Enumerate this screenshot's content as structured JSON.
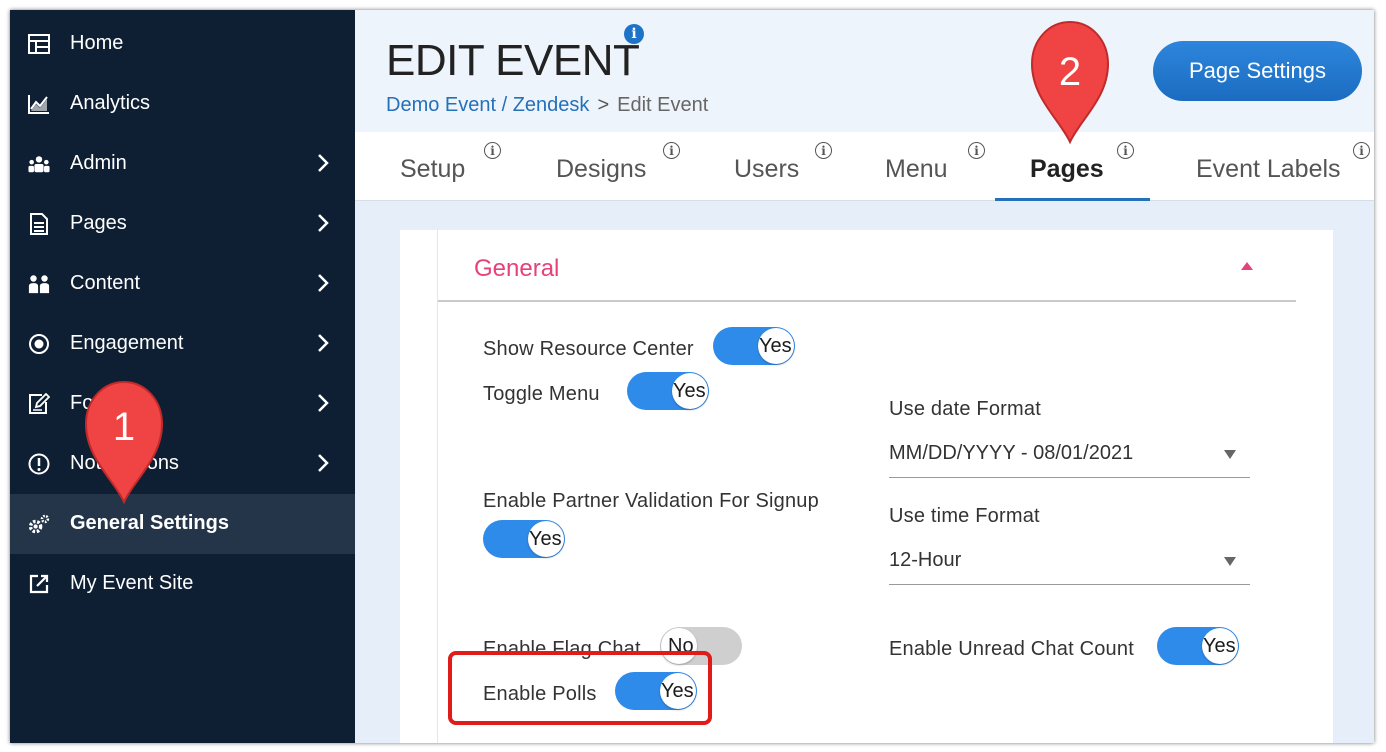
{
  "sidebar": {
    "items": [
      {
        "label": "Home",
        "icon": "home-grid-icon",
        "chevron": false
      },
      {
        "label": "Analytics",
        "icon": "analytics-chart-icon",
        "chevron": false
      },
      {
        "label": "Admin",
        "icon": "admin-users-icon",
        "chevron": true
      },
      {
        "label": "Pages",
        "icon": "document-icon",
        "chevron": true
      },
      {
        "label": "Content",
        "icon": "content-people-icon",
        "chevron": true
      },
      {
        "label": "Engagement",
        "icon": "target-icon",
        "chevron": true
      },
      {
        "label": "Forms",
        "icon": "edit-form-icon",
        "chevron": true
      },
      {
        "label": "Notifications",
        "icon": "alert-circle-icon",
        "chevron": true
      },
      {
        "label": "General Settings",
        "icon": "gears-icon",
        "chevron": false,
        "active": true
      },
      {
        "label": "My Event Site",
        "icon": "external-link-icon",
        "chevron": false
      }
    ]
  },
  "header": {
    "title": "EDIT EVENT",
    "info_icon": "i",
    "breadcrumb": {
      "link": "Demo Event / Zendesk",
      "separator": ">",
      "current": "Edit Event"
    },
    "page_settings_label": "Page Settings"
  },
  "tabs": [
    {
      "label": "Setup"
    },
    {
      "label": "Designs"
    },
    {
      "label": "Users"
    },
    {
      "label": "Menu"
    },
    {
      "label": "Pages",
      "active": true
    },
    {
      "label": "Event Labels"
    }
  ],
  "tab_info_glyph": "i",
  "general": {
    "title": "General",
    "settings": {
      "show_resource_center": {
        "label": "Show Resource Center",
        "value": "Yes"
      },
      "toggle_menu": {
        "label": "Toggle Menu",
        "value": "Yes"
      },
      "enable_partner_validation": {
        "label": "Enable Partner Validation For Signup",
        "value": "Yes"
      },
      "enable_flag_chat": {
        "label": "Enable Flag Chat",
        "value": "No"
      },
      "enable_polls": {
        "label": "Enable Polls",
        "value": "Yes"
      },
      "enable_unread_chat_count": {
        "label": "Enable Unread Chat Count",
        "value": "Yes"
      }
    },
    "date_format": {
      "label": "Use date Format",
      "value": "MM/DD/YYYY - 08/01/2021"
    },
    "time_format": {
      "label": "Use time Format",
      "value": "12-Hour"
    }
  },
  "annotations": {
    "marker_1": "1",
    "marker_2": "2",
    "marker_color": "#f04444"
  },
  "colors": {
    "sidebar_bg": "#0f1f33",
    "accent_blue": "#2470b9",
    "toggle_on": "#2f8bea",
    "section_title": "#e6427a"
  }
}
